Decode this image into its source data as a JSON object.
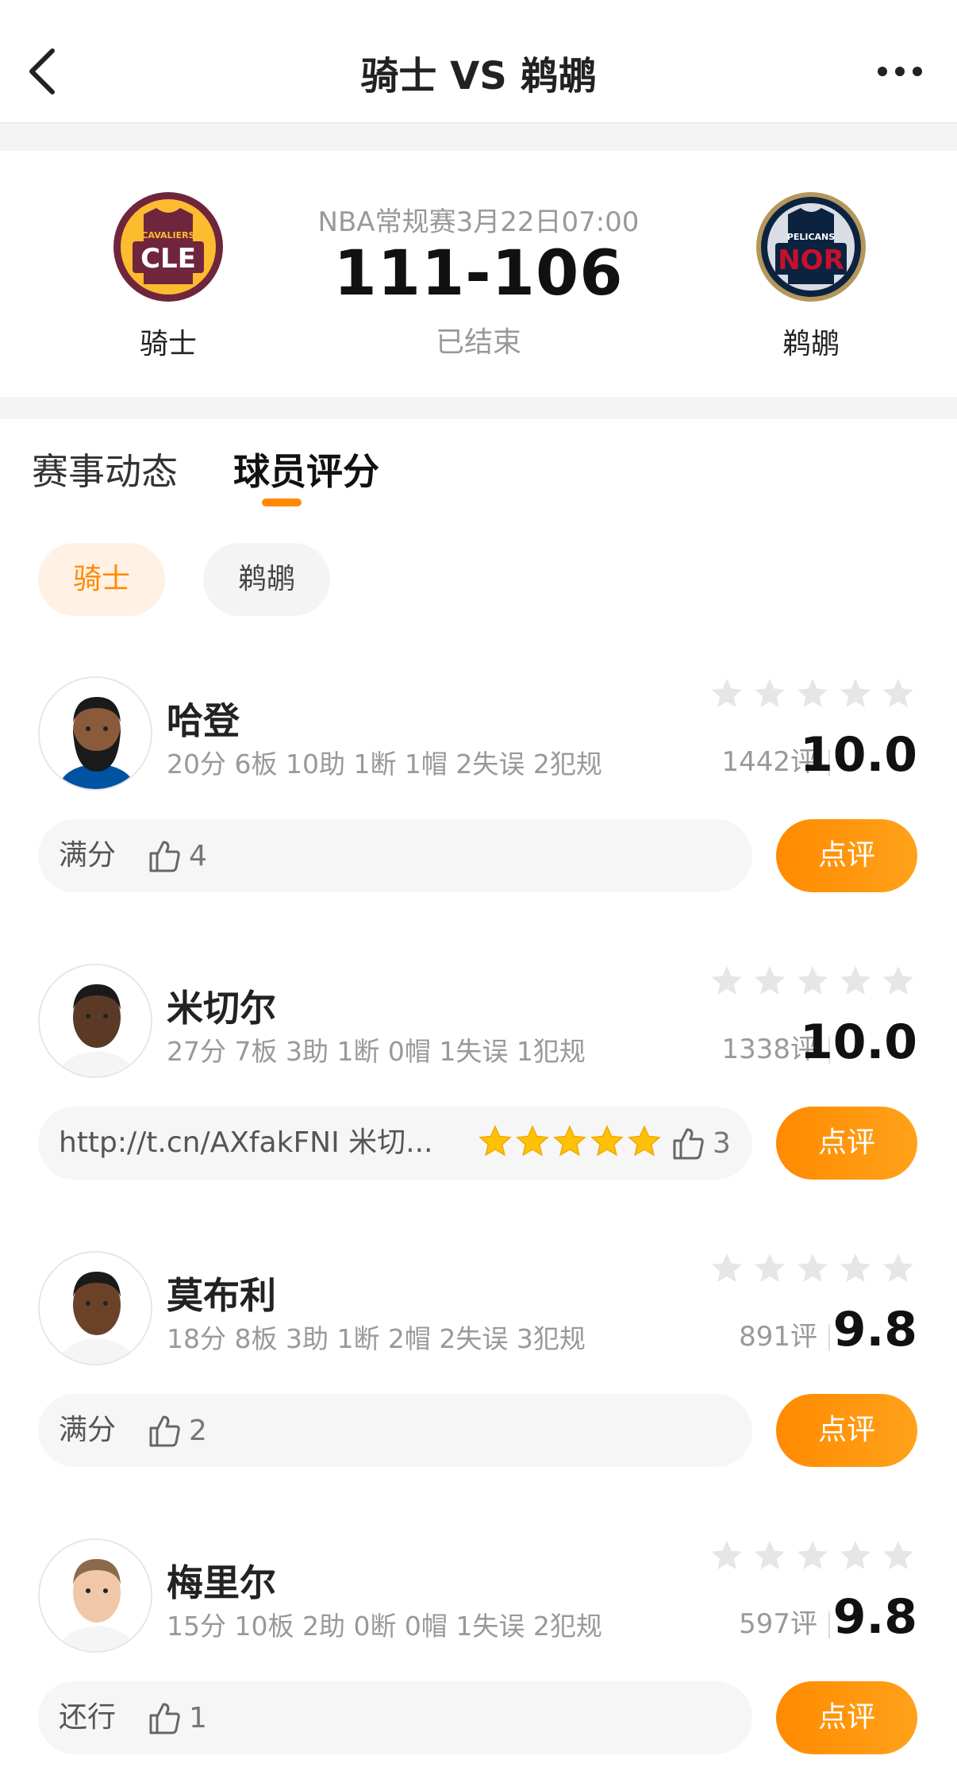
{
  "nav": {
    "title": "骑士 VS 鹈鹕"
  },
  "match": {
    "meta": "NBA常规赛3月22日07:00",
    "score": "111-106",
    "status": "已结束",
    "home": {
      "name": "骑士",
      "logo_text_top": "CAVALIERS",
      "logo_text": "CLE",
      "color": "#6f263d",
      "accent": "#fdbb30"
    },
    "away": {
      "name": "鹈鹕",
      "logo_text_top": "PELICANS",
      "logo_text": "NOR",
      "color": "#0c2340",
      "accent": "#c8102e"
    }
  },
  "tabs": {
    "events": "赛事动态",
    "ratings": "球员评分"
  },
  "team_filter": {
    "active": "骑士",
    "inactive": "鹈鹕"
  },
  "players": [
    {
      "name": "哈登",
      "stats": "20分 6板 10助 1断 1帽 2失误 2犯规",
      "count": "1442评",
      "rating": "10.0",
      "comment": "满分",
      "likes": "4",
      "stars_shown": 5,
      "comment_stars": 0
    },
    {
      "name": "米切尔",
      "stats": "27分 7板 3助 1断 0帽 1失误 1犯规",
      "count": "1338评",
      "rating": "10.0",
      "comment": "http://t.cn/AXfakFNI 米切...",
      "likes": "3",
      "stars_shown": 5,
      "comment_stars": 5
    },
    {
      "name": "莫布利",
      "stats": "18分 8板 3助 1断 2帽 2失误 3犯规",
      "count": "891评",
      "rating": "9.8",
      "comment": "满分",
      "likes": "2",
      "stars_shown": 5,
      "comment_stars": 0
    },
    {
      "name": "梅里尔",
      "stats": "15分 10板 2助 0断 0帽 1失误 2犯规",
      "count": "597评",
      "rating": "9.8",
      "comment": "还行",
      "likes": "1",
      "stars_shown": 5,
      "comment_stars": 0
    }
  ],
  "review_label": "点评",
  "colors": {
    "accent": "#ff8a00",
    "star_empty": "#e6e6e6",
    "star_filled": "#ffc107"
  }
}
